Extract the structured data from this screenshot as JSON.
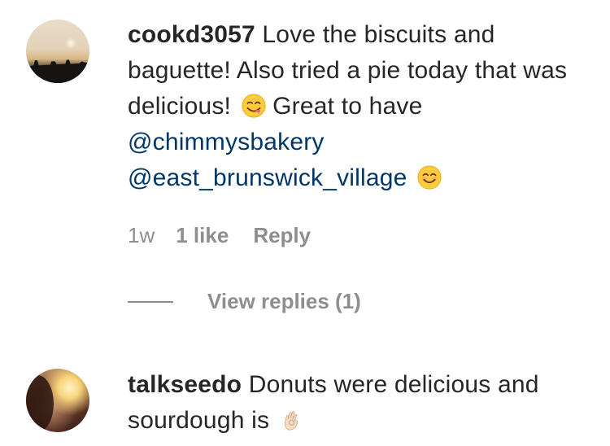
{
  "comments": [
    {
      "username": "cookd3057",
      "text_1": " Love the biscuits and baguette! Also tried a pie today that was delicious! ",
      "emoji_1": "face-savoring-food-icon",
      "text_2": " Great to have ",
      "mention_1": "@chimmysbakery",
      "text_3": " ",
      "mention_2": "@east_brunswick_village",
      "text_4": " ",
      "emoji_2": "smiling-face-icon",
      "time": "1w",
      "likes": "1 like",
      "reply": "Reply",
      "view_replies": "View replies (1)"
    },
    {
      "username": "talkseedo",
      "text_1": " Donuts were delicious and sourdough is ",
      "emoji_1": "ok-hand-icon"
    }
  ],
  "colors": {
    "text": "#262626",
    "mention": "#00376b",
    "muted": "#8e8e8e"
  }
}
